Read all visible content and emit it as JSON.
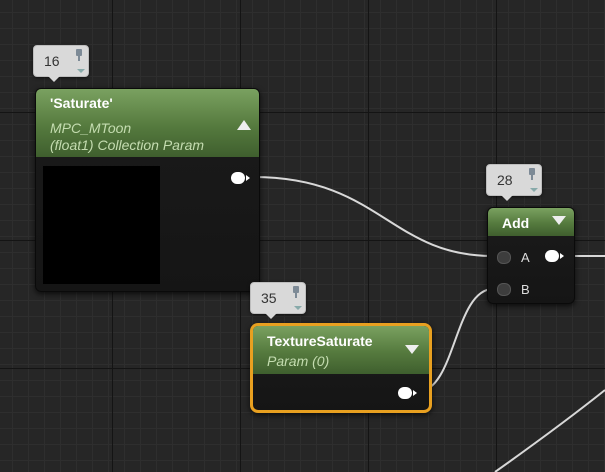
{
  "nodes": {
    "saturate": {
      "badge": "16",
      "title": "'Saturate'",
      "subtitle_line1": "MPC_MToon",
      "subtitle_line2": "(float1) Collection Param"
    },
    "add": {
      "badge": "28",
      "title": "Add",
      "input_a": "A",
      "input_b": "B"
    },
    "texture_saturate": {
      "badge": "35",
      "title": "TextureSaturate",
      "subtitle": "Param (0)"
    }
  },
  "colors": {
    "header_green": "#557a3e",
    "selection_outline": "#e8a020",
    "wire": "#d8d8d8",
    "grid_background": "#262626"
  }
}
